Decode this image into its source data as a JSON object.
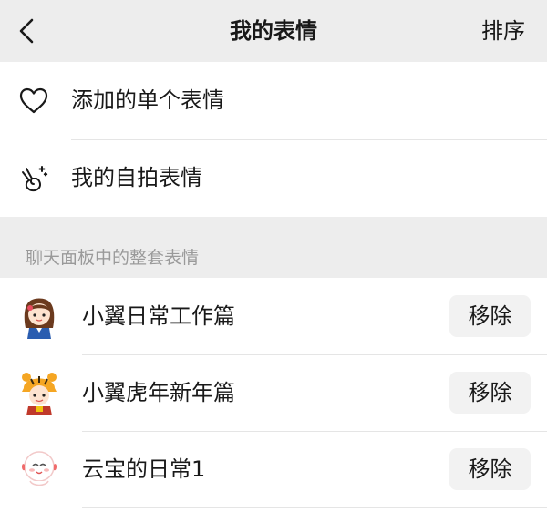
{
  "header": {
    "back_icon": "chevron-left-icon",
    "title": "我的表情",
    "sort_label": "排序"
  },
  "main_items": [
    {
      "label": "添加的单个表情",
      "icon": "heart-outline-icon"
    },
    {
      "label": "我的自拍表情",
      "icon": "victory-hand-sparkle-icon"
    }
  ],
  "section_title": "聊天面板中的整套表情",
  "packs": [
    {
      "name": "小翼日常工作篇",
      "thumb": "girl-sticker-avatar",
      "remove_label": "移除"
    },
    {
      "name": "小翼虎年新年篇",
      "thumb": "tiger-hat-sticker-avatar",
      "remove_label": "移除"
    },
    {
      "name": "云宝的日常1",
      "thumb": "cloud-mascot-sticker-avatar",
      "remove_label": "移除"
    }
  ],
  "colors": {
    "background": "#ededed",
    "surface": "#ffffff",
    "text": "#191919",
    "muted": "#9a9a9a",
    "divider": "#e5e5e5",
    "button_bg": "#f2f2f2"
  }
}
